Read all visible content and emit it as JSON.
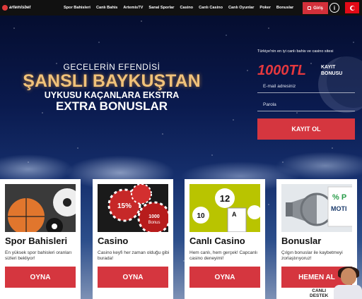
{
  "brand": {
    "logo_text": "artemisbet"
  },
  "nav": {
    "items": [
      "Spor Bahisleri",
      "Canlı Bahis",
      "ArtemisTV",
      "Sanal Sporlar",
      "Casino",
      "Canlı Casino",
      "Canlı Oyunlar",
      "Poker",
      "Bonuslar"
    ],
    "login_label": "Giriş",
    "info_label": "i"
  },
  "hero": {
    "line1": "GECELERİN EFENDİSİ",
    "line2": "ŞANSLI BAYKUŞTAN",
    "line3": "UYKUSU KAÇANLARA EKSTRA",
    "line4": "EXTRA BONUSLAR"
  },
  "signup": {
    "note": "Türkiye'nin en iyi canlı bahis ve casino sitesi",
    "bonus_amount": "1000TL",
    "bonus_label_1": "KAYIT",
    "bonus_label_2": "BONUSU",
    "email_placeholder": "E-mail adresiniz",
    "password_placeholder": "Parola",
    "submit_label": "KAYIT OL"
  },
  "cards": [
    {
      "title": "Spor Bahisleri",
      "desc": "En yüksek spor bahisleri oranları sizleri bekliyor!",
      "button": "OYNA"
    },
    {
      "title": "Casino",
      "desc": "Casino keyfi her zaman olduğu gibi burada!",
      "button": "OYNA"
    },
    {
      "title": "Canlı Casino",
      "desc": "Hem canlı, hem gerçek! Capcanlı casino deneyimi!",
      "button": "OYNA"
    },
    {
      "title": "Bonuslar",
      "desc": "Çılgın bonuslar ile kaybetmeyi zorlaştırıyoruz!",
      "button": "HEMEN AL"
    }
  ],
  "card_art": {
    "casino_chip_1": "15%",
    "casino_chip_2": "1000",
    "casino_chip_3": "Bonus",
    "live_ball_1": "12",
    "live_ball_2": "10",
    "live_card": "A",
    "bonus_sign_1": "% P",
    "bonus_sign_2": "MOTI"
  },
  "support": {
    "line1": "CANLI",
    "line2": "DESTEK"
  },
  "colors": {
    "accent": "#d5363f",
    "bonus_red": "#e5383e",
    "gold": "#f1c27a",
    "nav_bg": "#111111"
  }
}
